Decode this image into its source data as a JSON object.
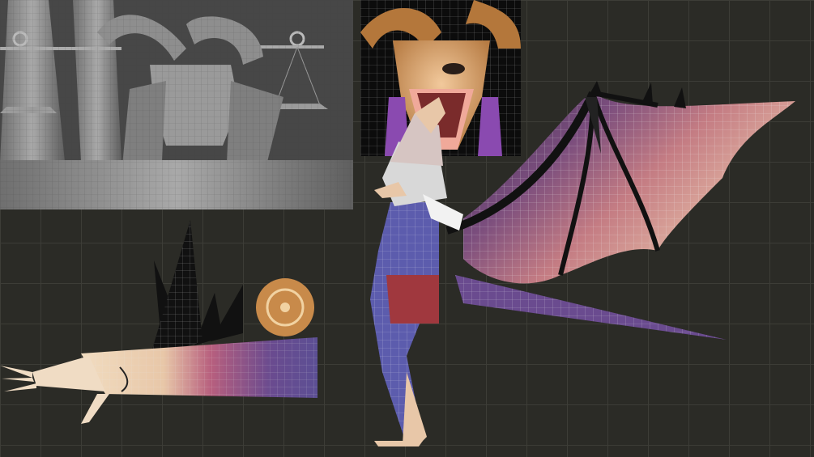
{
  "scene": {
    "panels": [
      {
        "id": "sculpt",
        "depiction": "gray-sculpt"
      },
      {
        "id": "face",
        "depiction": "textured-face-closeup"
      },
      {
        "id": "arm",
        "depiction": "arm-wireframe"
      },
      {
        "id": "body",
        "depiction": "full-body-wings"
      }
    ],
    "colors": {
      "background": "#2b2b26",
      "grid": "#3d3d37",
      "sculpt_gray": "#9a9a9a",
      "skin_peach": "#e8c7a8",
      "skin_purple": "#6a4b8f",
      "wing_red": "#a0383e",
      "horn_gold": "#c88a4a"
    }
  }
}
